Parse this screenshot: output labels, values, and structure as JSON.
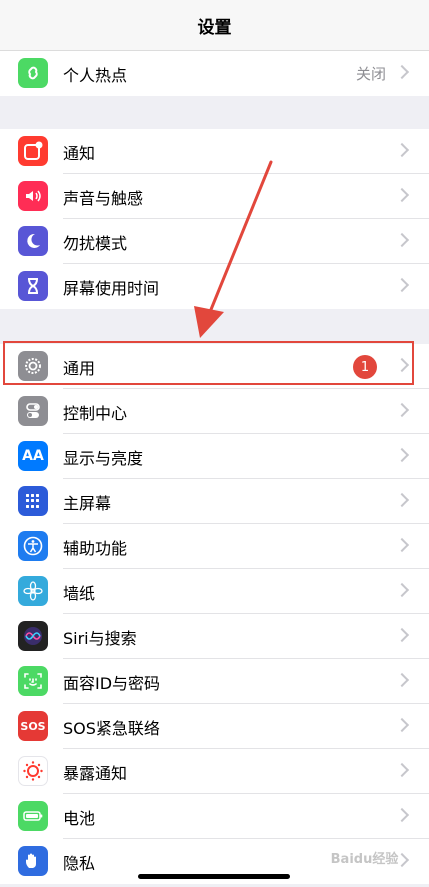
{
  "nav": {
    "title": "设置"
  },
  "group_top": [
    {
      "id": "hotspot",
      "label": "个人热点",
      "value": "关闭",
      "icon": "hotspot-icon",
      "color": "#4cd964"
    }
  ],
  "group_notifications": [
    {
      "id": "notifications",
      "label": "通知",
      "icon": "notification-icon",
      "color": "#ff3b30"
    },
    {
      "id": "sounds",
      "label": "声音与触感",
      "icon": "speaker-icon",
      "color": "#ff2d55"
    },
    {
      "id": "dnd",
      "label": "勿扰模式",
      "icon": "moon-icon",
      "color": "#5856d6"
    },
    {
      "id": "screentime",
      "label": "屏幕使用时间",
      "icon": "hourglass-icon",
      "color": "#5856d6"
    }
  ],
  "group_general": [
    {
      "id": "general",
      "label": "通用",
      "badge": "1",
      "icon": "gear-icon",
      "color": "#8e8e93"
    },
    {
      "id": "control-center",
      "label": "控制中心",
      "icon": "toggle-icon",
      "color": "#8e8e93"
    },
    {
      "id": "display",
      "label": "显示与亮度",
      "icon": "aa-text-icon",
      "color": "#007aff"
    },
    {
      "id": "home-screen",
      "label": "主屏幕",
      "icon": "app-grid-icon",
      "color": "#2c5bd9"
    },
    {
      "id": "accessibility",
      "label": "辅助功能",
      "icon": "accessibility-icon",
      "color": "#1e7cf0"
    },
    {
      "id": "wallpaper",
      "label": "墙纸",
      "icon": "flower-icon",
      "color": "#34aadc"
    },
    {
      "id": "siri",
      "label": "Siri与搜索",
      "icon": "siri-icon",
      "color": "#222222"
    },
    {
      "id": "faceid",
      "label": "面容ID与密码",
      "icon": "face-id-icon",
      "color": "#4cd964"
    },
    {
      "id": "sos",
      "label": "SOS紧急联络",
      "icon_text": "SOS",
      "icon": "sos-icon",
      "color": "#e53935"
    },
    {
      "id": "exposure",
      "label": "暴露通知",
      "icon": "exposure-icon",
      "color": "#ffffff"
    },
    {
      "id": "battery",
      "label": "电池",
      "icon": "battery-icon",
      "color": "#4cd964"
    },
    {
      "id": "privacy",
      "label": "隐私",
      "icon": "hand-icon",
      "color": "#2f6ce0"
    }
  ],
  "aa_text": "AA",
  "watermark": "Baidu经验",
  "highlight_color": "#e2473c"
}
